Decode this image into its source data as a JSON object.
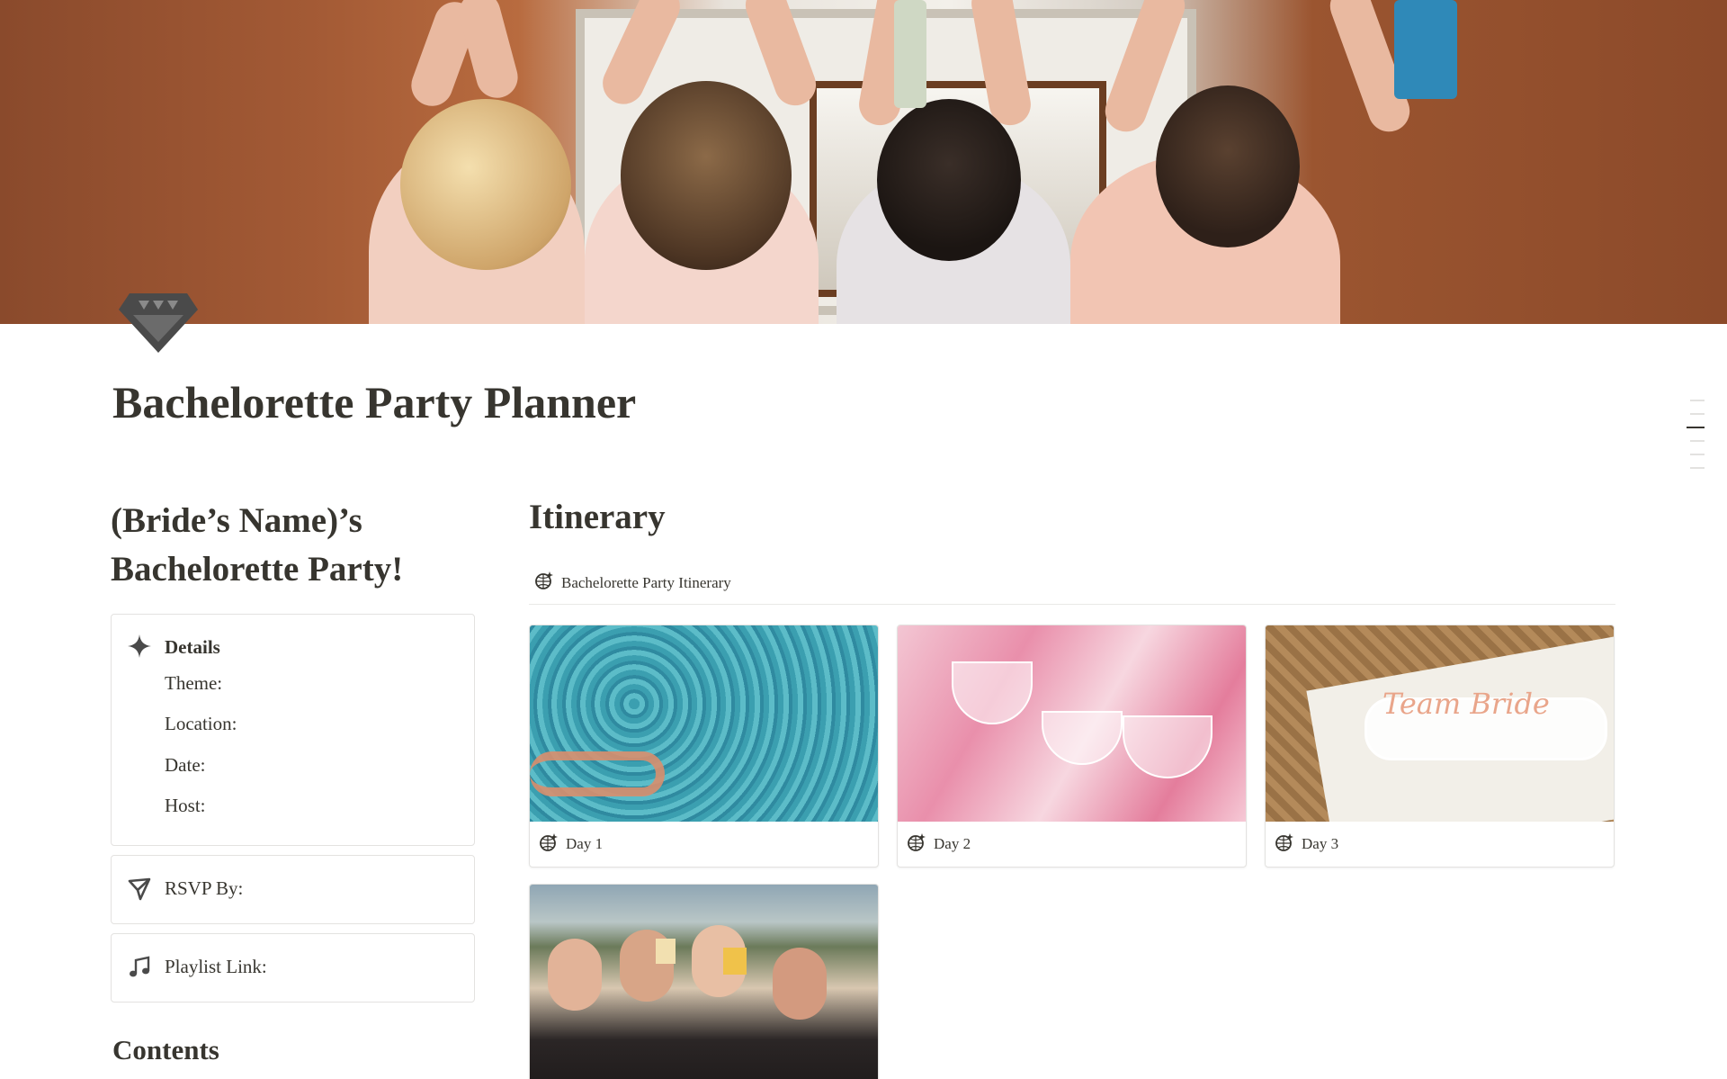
{
  "page": {
    "title": "Bachelorette Party Planner",
    "icon": "diamond-icon"
  },
  "left": {
    "heading": "(Bride’s Name)’s Bachelorette Party!",
    "details": {
      "icon": "sparkle-icon",
      "title": "Details",
      "lines": [
        "Theme:",
        "Location:",
        "Date:",
        "Host:"
      ]
    },
    "rsvp": {
      "icon": "paper-plane-icon",
      "label": "RSVP By:"
    },
    "playlist": {
      "icon": "music-note-icon",
      "label": "Playlist Link:"
    },
    "contents_heading": "Contents"
  },
  "itinerary": {
    "heading": "Itinerary",
    "view_tab": {
      "icon": "disco-ball-icon",
      "label": "Bachelorette Party Itinerary"
    },
    "cards": [
      {
        "label": "Day 1",
        "icon": "disco-ball-icon"
      },
      {
        "label": "Day 2",
        "icon": "disco-ball-icon"
      },
      {
        "label": "Day 3",
        "icon": "disco-ball-icon"
      },
      {
        "label": "",
        "icon": ""
      }
    ]
  },
  "colors": {
    "text": "#37352f",
    "border": "#e3e2e0",
    "icon_dark": "#4a4a4a"
  }
}
